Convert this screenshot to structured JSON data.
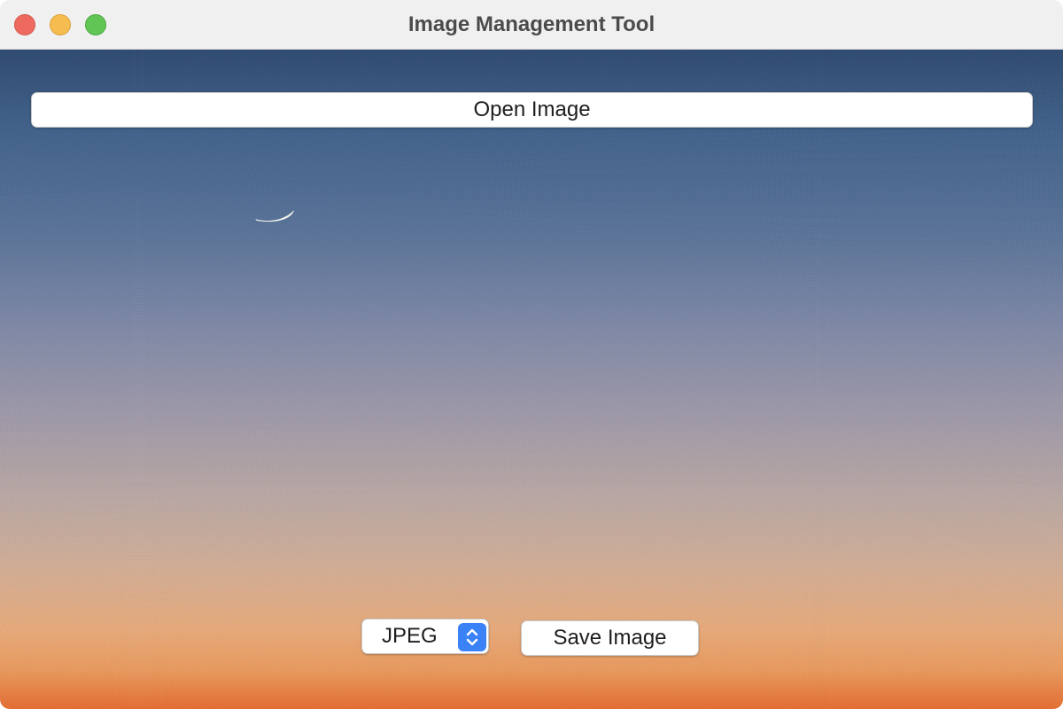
{
  "window": {
    "title": "Image Management Tool"
  },
  "toolbar": {
    "open_label": "Open Image"
  },
  "format": {
    "selected": "JPEG"
  },
  "actions": {
    "save_label": "Save Image"
  },
  "colors": {
    "close": "#ee6a5f",
    "minimize": "#f5bd4f",
    "maximize": "#61c555",
    "accent": "#3b82f6"
  },
  "icons": {
    "stepper": "chevron-up-down-icon",
    "image_moon": "crescent-moon-icon"
  }
}
